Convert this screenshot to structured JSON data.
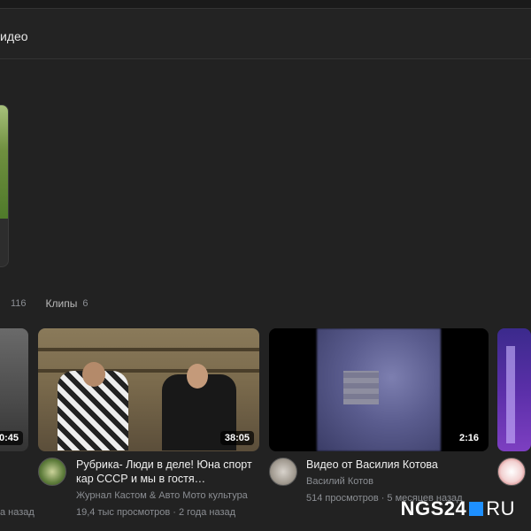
{
  "subheader": {
    "title": "идео"
  },
  "tabs": [
    {
      "label": "",
      "count": "116"
    },
    {
      "label": "Клипы",
      "count": "6"
    }
  ],
  "cards": [
    {
      "duration": "0:45",
      "title": "",
      "author": "",
      "views": "а назад"
    },
    {
      "duration": "38:05",
      "title": "Рубрика- Люди в деле! Юна спорт кар СССР и мы в гостя…",
      "author": "Журнал Кастом & Авто Мото культура",
      "views": "19,4 тыс просмотров · 2 года назад"
    },
    {
      "duration": "2:16",
      "title": "Видео от Василия Котова",
      "author": "Василий Котов",
      "views": "514 просмотров · 5 месяцев назад"
    },
    {
      "duration": "",
      "title": "",
      "author": "",
      "views": ""
    }
  ],
  "watermark": {
    "main": "NGS24",
    "suffix": "RU"
  },
  "colors": {
    "background": "#222222",
    "accent": "#1e90ff"
  }
}
